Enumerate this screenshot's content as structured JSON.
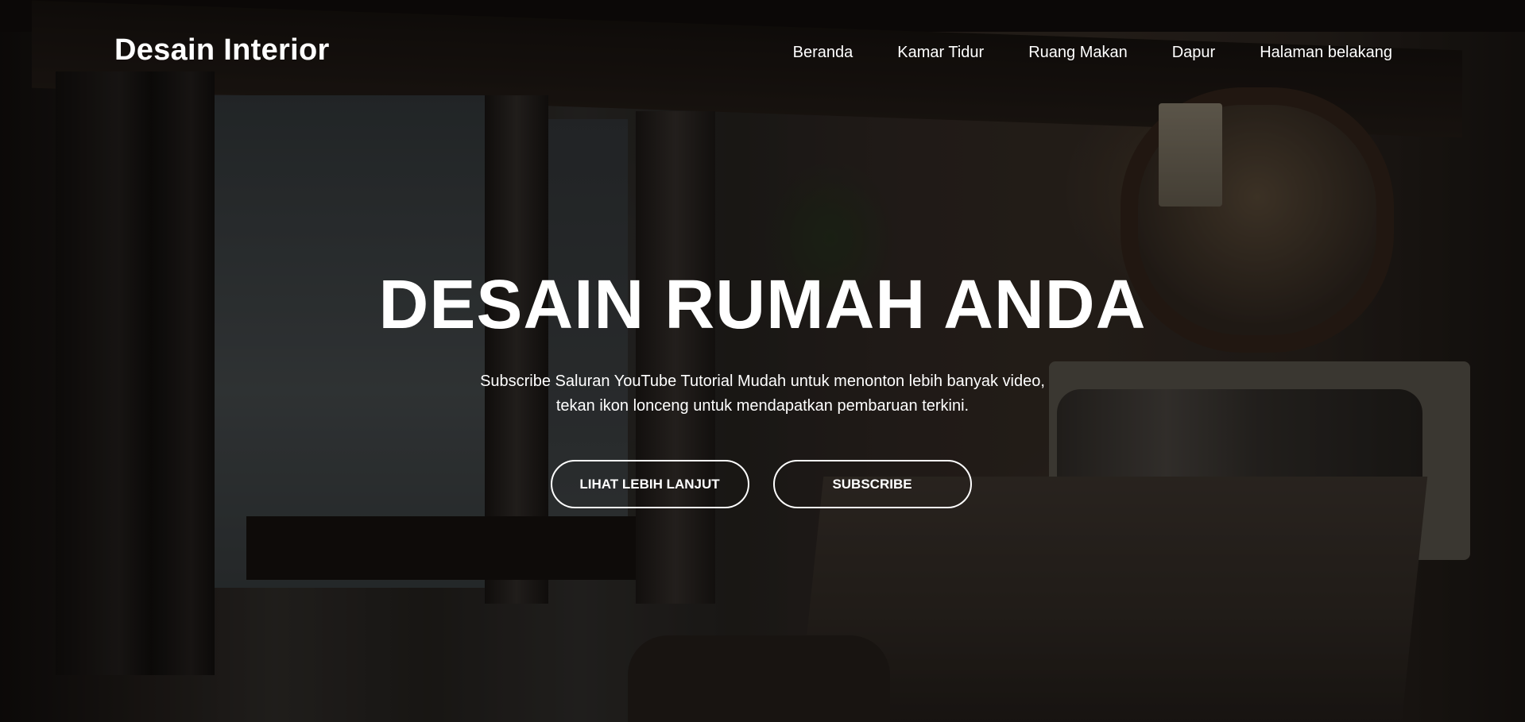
{
  "brand": {
    "title": "Desain Interior"
  },
  "nav": {
    "items": [
      {
        "label": "Beranda"
      },
      {
        "label": "Kamar Tidur"
      },
      {
        "label": "Ruang Makan"
      },
      {
        "label": "Dapur"
      },
      {
        "label": "Halaman belakang"
      }
    ]
  },
  "hero": {
    "headline": "DESAIN RUMAH ANDA",
    "subtitle_line1": "Subscribe Saluran YouTube Tutorial Mudah untuk menonton lebih banyak video,",
    "subtitle_line2": "tekan ikon lonceng untuk mendapatkan pembaruan terkini.",
    "buttons": {
      "primary_label": "LIHAT LEBIH LANJUT",
      "secondary_label": "SUBSCRIBE"
    }
  },
  "theme": {
    "text_color": "#ffffff",
    "overlay_color": "#000000"
  }
}
